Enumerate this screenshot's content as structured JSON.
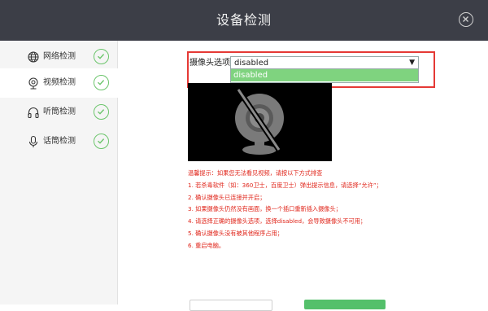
{
  "window": {
    "title": "设备检测",
    "close_icon": "close-circle-icon"
  },
  "sidebar": {
    "items": [
      {
        "label": "网络检测",
        "icon": "globe-icon",
        "status": "passed",
        "active": false
      },
      {
        "label": "视频检测",
        "icon": "webcam-icon",
        "status": "passed",
        "active": true
      },
      {
        "label": "听筒检测",
        "icon": "headphones-icon",
        "status": "passed",
        "active": false
      },
      {
        "label": "话筒检测",
        "icon": "microphone-icon",
        "status": "passed",
        "active": false
      }
    ]
  },
  "camera": {
    "label": "摄像头选项",
    "selected": "disabled",
    "options": [
      "disabled"
    ],
    "preview_icon": "camera-disabled-icon"
  },
  "tips": {
    "lines": [
      "温馨提示：如果您无法看见视频，请按以下方式排查",
      "1. 若杀毒软件（如：360卫士，百度卫士）弹出提示信息，请选择“允许”；",
      "2. 确认摄像头已连接并开启；",
      "3. 如果摄像头仍然没有画面，换一个插口重新插入摄像头；",
      "4. 请选择正确的摄像头选项，选择disabled，会导致摄像头不可用；",
      "5. 确认摄像头没有被其他程序占用；",
      "6. 重启电脑。"
    ]
  },
  "colors": {
    "titlebar": "#3c3e47",
    "accent_green": "#6cc56c",
    "warning_red": "#e0261b",
    "highlight_red": "#e53935"
  }
}
